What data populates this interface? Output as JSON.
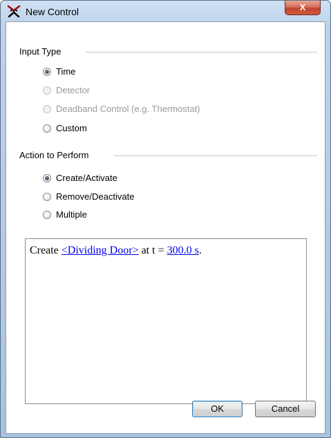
{
  "window": {
    "title": "New Control",
    "close_label": "X"
  },
  "input_type": {
    "label": "Input Type",
    "options": [
      {
        "label": "Time",
        "selected": true,
        "enabled": true
      },
      {
        "label": "Detector",
        "selected": false,
        "enabled": false
      },
      {
        "label": "Deadband Control (e.g. Thermostat)",
        "selected": false,
        "enabled": false
      },
      {
        "label": "Custom",
        "selected": false,
        "enabled": true
      }
    ]
  },
  "action": {
    "label": "Action to Perform",
    "options": [
      {
        "label": "Create/Activate",
        "selected": true,
        "enabled": true
      },
      {
        "label": "Remove/Deactivate",
        "selected": false,
        "enabled": true
      },
      {
        "label": "Multiple",
        "selected": false,
        "enabled": true
      }
    ]
  },
  "summary": {
    "prefix": "Create ",
    "object_link": "<Dividing Door>",
    "middle": " at t = ",
    "time_link": "300.0 s",
    "suffix": "."
  },
  "buttons": {
    "ok": "OK",
    "cancel": "Cancel"
  },
  "colors": {
    "link": "#0000ee",
    "close_button": "#c1452d",
    "frame": "#bcd2ea"
  }
}
